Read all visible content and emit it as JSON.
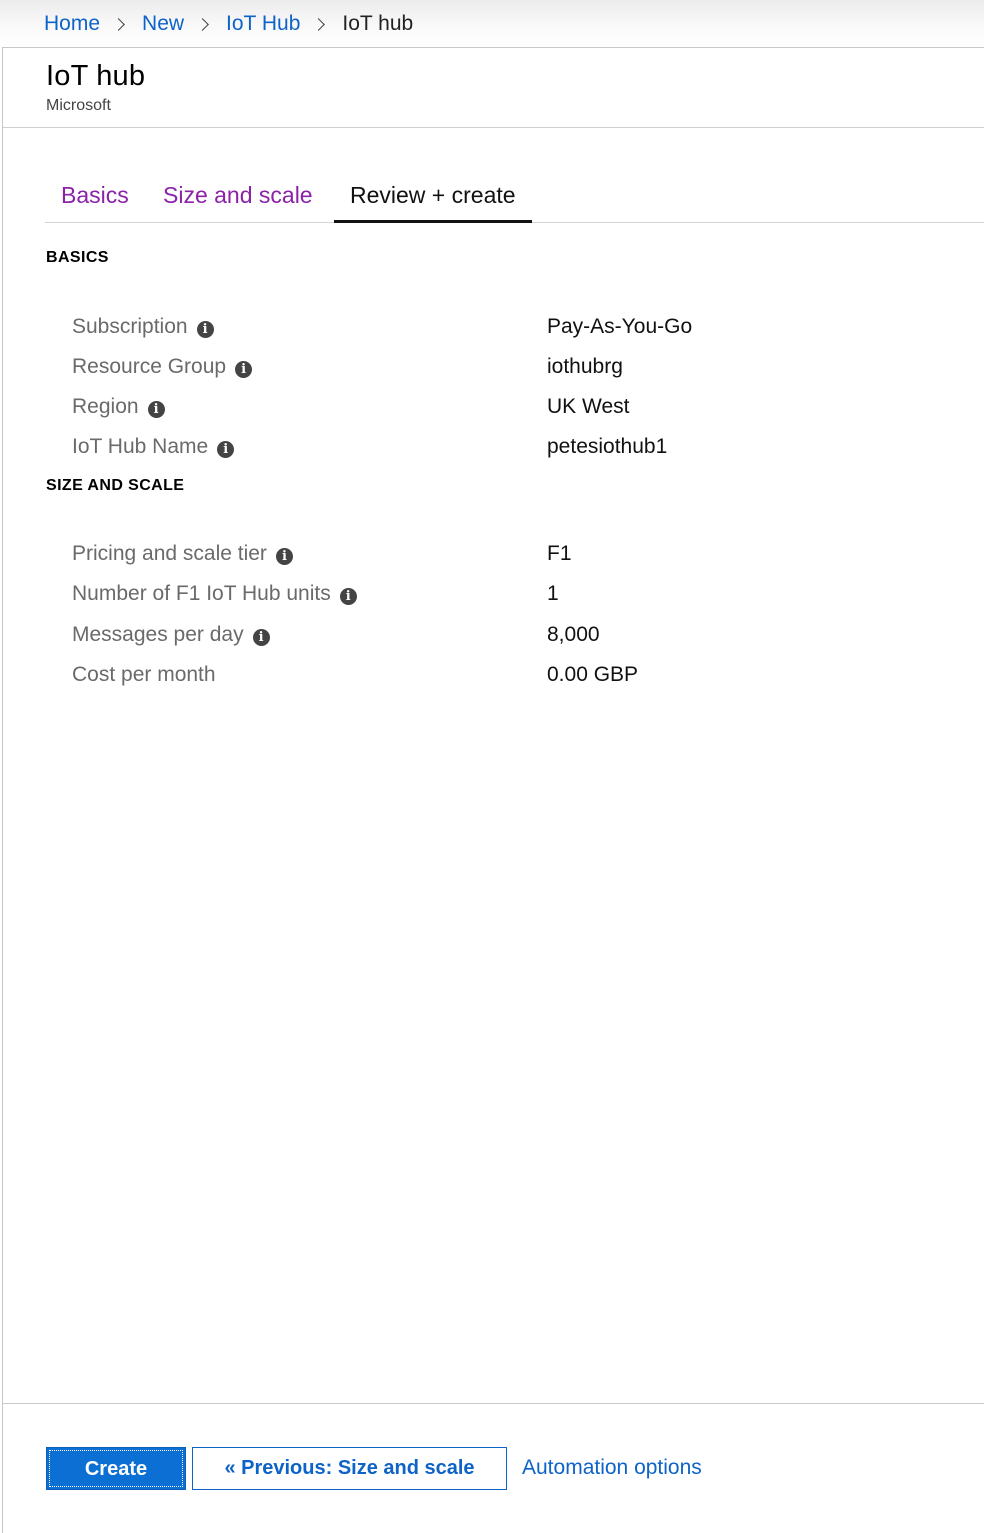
{
  "breadcrumb": {
    "items": [
      "Home",
      "New",
      "IoT Hub"
    ],
    "current": "IoT hub"
  },
  "header": {
    "title": "IoT hub",
    "subtitle": "Microsoft"
  },
  "tabs": [
    {
      "label": "Basics",
      "active": false
    },
    {
      "label": "Size and scale",
      "active": false
    },
    {
      "label": "Review + create",
      "active": true
    }
  ],
  "basics": {
    "heading": "BASICS",
    "rows": [
      {
        "label": "Subscription",
        "value": "Pay-As-You-Go",
        "info": true
      },
      {
        "label": "Resource Group",
        "value": "iothubrg",
        "info": true
      },
      {
        "label": "Region",
        "value": "UK West",
        "info": true
      },
      {
        "label": "IoT Hub Name",
        "value": "petesiothub1",
        "info": true
      }
    ]
  },
  "size_and_scale": {
    "heading": "SIZE AND SCALE",
    "rows": [
      {
        "label": "Pricing and scale tier",
        "value": "F1",
        "info": true
      },
      {
        "label": "Number of F1 IoT Hub units",
        "value": "1",
        "info": true
      },
      {
        "label": "Messages per day",
        "value": "8,000",
        "info": true
      },
      {
        "label": "Cost per month",
        "value": "0.00 GBP",
        "info": false
      }
    ]
  },
  "footer": {
    "create_label": "Create",
    "previous_label": "« Previous: Size and scale",
    "automation_label": "Automation options"
  },
  "icons": {
    "info": "info-icon",
    "breadcrumb_separator": "chevron-right-icon"
  },
  "colors": {
    "link": "#0e63c8",
    "tab_inactive": "#8b22a8",
    "primary_button": "#0b6fd4"
  }
}
